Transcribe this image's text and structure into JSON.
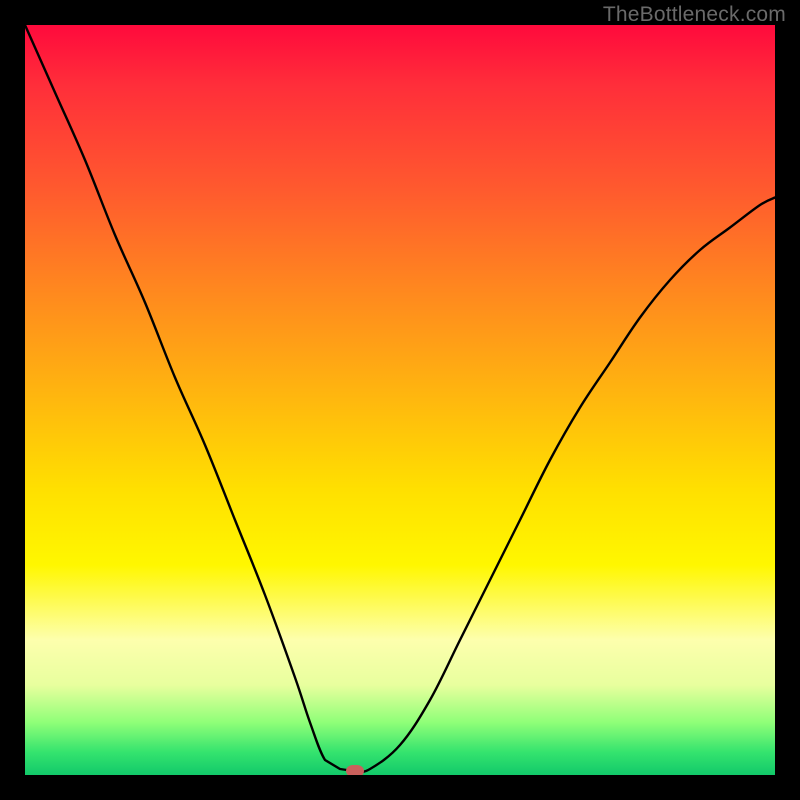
{
  "watermark": "TheBottleneck.com",
  "colors": {
    "frame": "#000000",
    "curve": "#000000",
    "marker": "#c9605c",
    "gradient_top": "#ff0a3c",
    "gradient_bottom": "#12c96a"
  },
  "chart_data": {
    "type": "line",
    "title": "",
    "xlabel": "",
    "ylabel": "",
    "xlim": [
      0,
      100
    ],
    "ylim": [
      0,
      100
    ],
    "grid": false,
    "legend": false,
    "note": "V-shaped bottleneck curve; axes unlabeled in source image. Values approximated from pixel positions on a 0–100 normalized scale (y increases upward).",
    "series": [
      {
        "name": "bottleneck-curve",
        "x": [
          0,
          4,
          8,
          12,
          16,
          20,
          24,
          28,
          32,
          36,
          38,
          40,
          42,
          44,
          46,
          50,
          54,
          58,
          62,
          66,
          70,
          74,
          78,
          82,
          86,
          90,
          94,
          98,
          100
        ],
        "y": [
          100,
          91,
          82,
          72,
          63,
          53,
          44,
          34,
          24,
          13,
          7,
          2,
          0.8,
          0.5,
          0.8,
          4,
          10,
          18,
          26,
          34,
          42,
          49,
          55,
          61,
          66,
          70,
          73,
          76,
          77
        ]
      }
    ],
    "flat_bottom": {
      "x_start": 40,
      "x_end": 44,
      "y": 0.6
    },
    "marker": {
      "x": 44,
      "y": 0.6,
      "shape": "rounded-pill"
    }
  }
}
